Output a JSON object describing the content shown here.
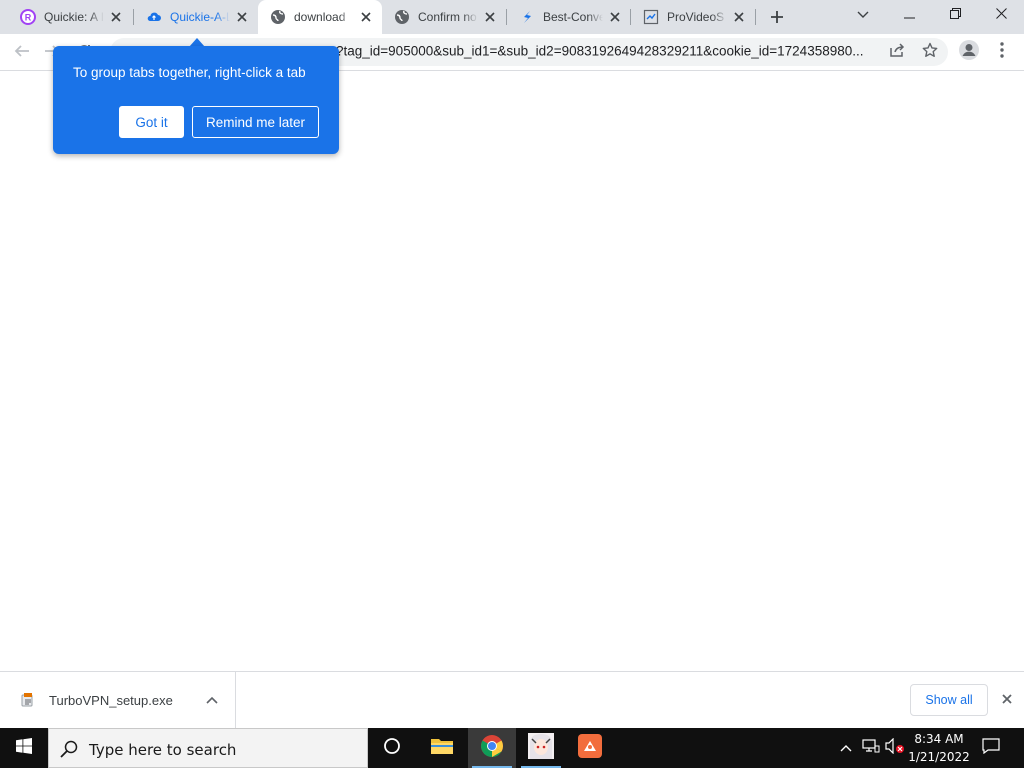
{
  "browser": {
    "tabs": [
      {
        "title": "Quickie: A I",
        "favicon": "rb-logo-icon",
        "active": false
      },
      {
        "title": "Quickie-A-L",
        "favicon": "cloud-icon",
        "active": false
      },
      {
        "title": "download",
        "favicon": "globe-icon",
        "active": true
      },
      {
        "title": "Confirm no",
        "favicon": "globe-icon",
        "active": false
      },
      {
        "title": "Best-Conve",
        "favicon": "s-logo-icon",
        "active": false
      },
      {
        "title": "ProVideoS",
        "favicon": "provideo-icon",
        "active": false
      }
    ],
    "url": "?tag_id=905000&sub_id1=&sub_id2=9083192649428329211&cookie_id=1724358980..."
  },
  "bubble": {
    "text": "To group tabs together, right-click a tab",
    "primary_button": "Got it",
    "secondary_button": "Remind me later"
  },
  "downloads": {
    "file_name": "TurboVPN_setup.exe",
    "show_all_label": "Show all"
  },
  "taskbar": {
    "search_placeholder": "Type here to search",
    "time": "8:34 AM",
    "date": "1/21/2022"
  },
  "colors": {
    "accent": "#1a73e8",
    "tabstrip": "#dee1e6",
    "taskbar": "#101010"
  }
}
